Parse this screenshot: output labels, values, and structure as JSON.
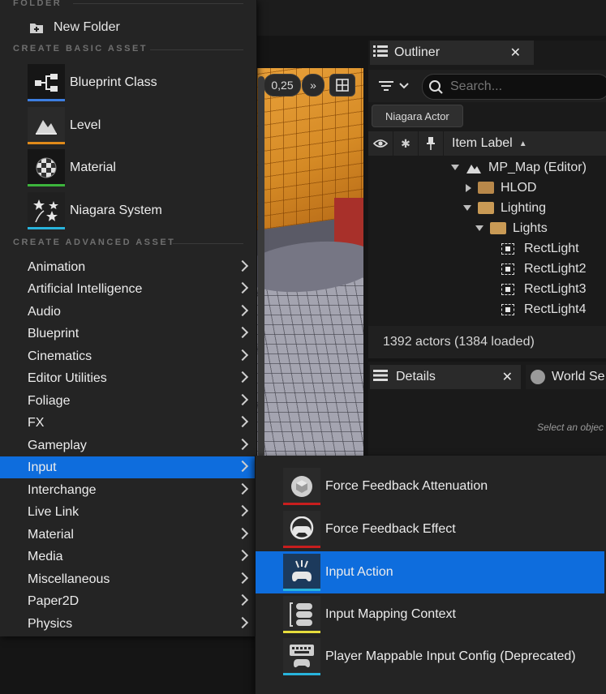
{
  "menu": {
    "folder_header": "FOLDER",
    "new_folder_label": "New Folder",
    "basic_header": "CREATE BASIC ASSET",
    "basic_assets": [
      {
        "label": "Blueprint Class",
        "color": "#3d7ee0"
      },
      {
        "label": "Level",
        "color": "#e08a1a"
      },
      {
        "label": "Material",
        "color": "#3cb43c"
      },
      {
        "label": "Niagara System",
        "color": "#28b4dc"
      }
    ],
    "advanced_header": "CREATE ADVANCED ASSET",
    "categories": [
      {
        "label": "Animation"
      },
      {
        "label": "Artificial Intelligence"
      },
      {
        "label": "Audio"
      },
      {
        "label": "Blueprint"
      },
      {
        "label": "Cinematics"
      },
      {
        "label": "Editor Utilities"
      },
      {
        "label": "Foliage"
      },
      {
        "label": "FX"
      },
      {
        "label": "Gameplay"
      },
      {
        "label": "Input"
      },
      {
        "label": "Interchange"
      },
      {
        "label": "Live Link"
      },
      {
        "label": "Material"
      },
      {
        "label": "Media"
      },
      {
        "label": "Miscellaneous"
      },
      {
        "label": "Paper2D"
      },
      {
        "label": "Physics"
      }
    ],
    "active_category": "Input"
  },
  "submenu": {
    "items": [
      {
        "label": "Force Feedback Attenuation",
        "color": "#c81e1e"
      },
      {
        "label": "Force Feedback Effect",
        "color": "#c81e1e"
      },
      {
        "label": "Input Action",
        "color": "#28b4dc"
      },
      {
        "label": "Input Mapping Context",
        "color": "#e6dc3c"
      },
      {
        "label": "Player Mappable Input Config (Deprecated)",
        "color": "#28b4dc"
      }
    ],
    "active_item": "Input Action"
  },
  "viewport": {
    "speed_label": "0,25"
  },
  "outliner": {
    "title": "Outliner",
    "search_placeholder": "Search...",
    "filter_chip": "Niagara Actor",
    "column_label": "Item Label",
    "rows": [
      {
        "label": "MP_Map (Editor)"
      },
      {
        "label": "HLOD"
      },
      {
        "label": "Lighting"
      },
      {
        "label": "Lights"
      },
      {
        "label": "RectLight"
      },
      {
        "label": "RectLight2"
      },
      {
        "label": "RectLight3"
      },
      {
        "label": "RectLight4"
      }
    ],
    "actor_count": "1392 actors (1384 loaded)"
  },
  "details": {
    "title": "Details",
    "world_tab": "World Se",
    "hint": "Select an objec"
  },
  "colors": {
    "accent": "#0e6ddd",
    "panel": "#242424"
  }
}
